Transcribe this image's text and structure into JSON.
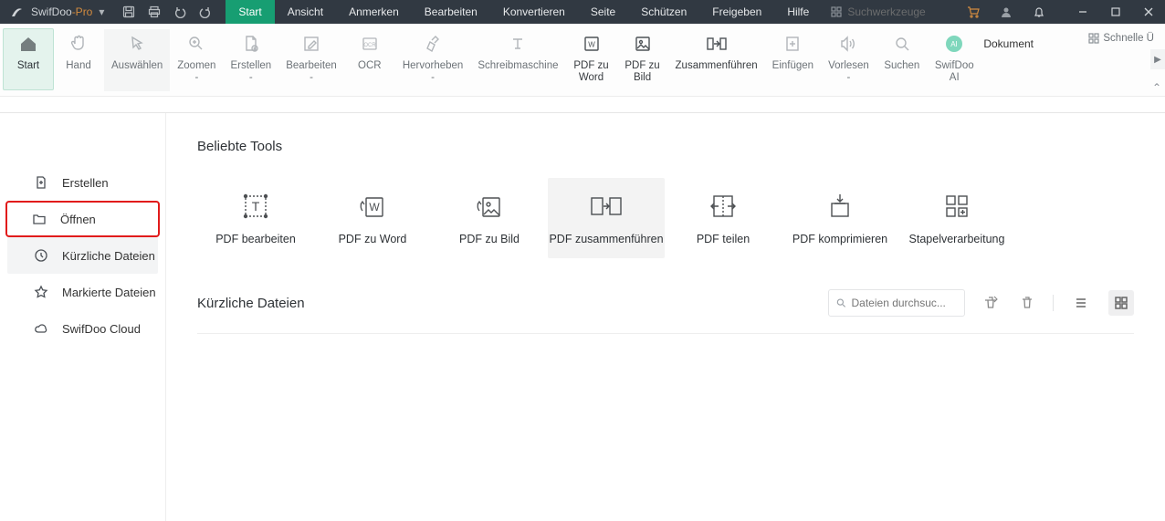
{
  "app": {
    "name": "SwifDoo",
    "suffix": "-Pro"
  },
  "menus": [
    "Start",
    "Ansicht",
    "Anmerken",
    "Bearbeiten",
    "Konvertieren",
    "Seite",
    "Schützen",
    "Freigeben",
    "Hilfe"
  ],
  "search_tools_placeholder": "Suchwerkzeuge",
  "ribbon": [
    {
      "label": "Start",
      "sub": ""
    },
    {
      "label": "Hand",
      "sub": ""
    },
    {
      "label": "Auswählen",
      "sub": ""
    },
    {
      "label": "Zoomen",
      "sub": "-"
    },
    {
      "label": "Erstellen",
      "sub": "-"
    },
    {
      "label": "Bearbeiten",
      "sub": "-"
    },
    {
      "label": "OCR",
      "sub": ""
    },
    {
      "label": "Hervorheben",
      "sub": "-"
    },
    {
      "label": "Schreibmaschine",
      "sub": ""
    },
    {
      "label": "PDF zu",
      "sub": "Word"
    },
    {
      "label": "PDF zu",
      "sub": "Bild"
    },
    {
      "label": "Zusammenführen",
      "sub": ""
    },
    {
      "label": "Einfügen",
      "sub": ""
    },
    {
      "label": "Vorlesen",
      "sub": "-"
    },
    {
      "label": "Suchen",
      "sub": ""
    },
    {
      "label": "SwifDoo",
      "sub": "AI"
    },
    {
      "label": "Dokument",
      "sub": ""
    }
  ],
  "quick_access": "Schnelle Ü",
  "sidebar": {
    "items": [
      {
        "label": "Erstellen"
      },
      {
        "label": "Öffnen"
      },
      {
        "label": "Kürzliche Dateien"
      },
      {
        "label": "Markierte Dateien"
      },
      {
        "label": "SwifDoo Cloud"
      }
    ]
  },
  "sections": {
    "popular_title": "Beliebte Tools",
    "recent_title": "Kürzliche Dateien"
  },
  "tools": [
    {
      "label": "PDF bearbeiten"
    },
    {
      "label": "PDF zu Word"
    },
    {
      "label": "PDF zu Bild"
    },
    {
      "label": "PDF zusammenführen"
    },
    {
      "label": "PDF teilen"
    },
    {
      "label": "PDF komprimieren"
    },
    {
      "label": "Stapelverarbeitung"
    }
  ],
  "recent_search_placeholder": "Dateien durchsuc..."
}
